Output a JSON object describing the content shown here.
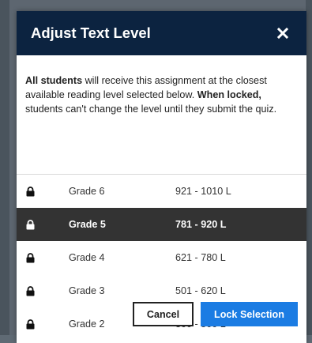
{
  "dialog": {
    "title": "Adjust Text Level",
    "close_icon": "close-icon",
    "description": {
      "part1_bold": "All students",
      "part2": " will receive this assignment at the closest available reading level selected below. ",
      "part3_bold": "When locked,",
      "part4": " students can't change the level until they submit the quiz."
    }
  },
  "levels": [
    {
      "grade": "Grade 6",
      "range": "921 - 1010 L",
      "selected": false,
      "icon": "lock-icon"
    },
    {
      "grade": "Grade 5",
      "range": "781 - 920 L",
      "selected": true,
      "icon": "lock-icon"
    },
    {
      "grade": "Grade 4",
      "range": "621 - 780 L",
      "selected": false,
      "icon": "lock-icon"
    },
    {
      "grade": "Grade 3",
      "range": "501 - 620 L",
      "selected": false,
      "icon": "lock-icon"
    },
    {
      "grade": "Grade 2",
      "range": "300 - 500 L",
      "selected": false,
      "icon": "lock-icon"
    }
  ],
  "footer": {
    "cancel_label": "Cancel",
    "lock_label": "Lock Selection"
  },
  "colors": {
    "header_bg": "#0c2340",
    "selected_row_bg": "#333333",
    "primary_button": "#1b7ce3"
  }
}
